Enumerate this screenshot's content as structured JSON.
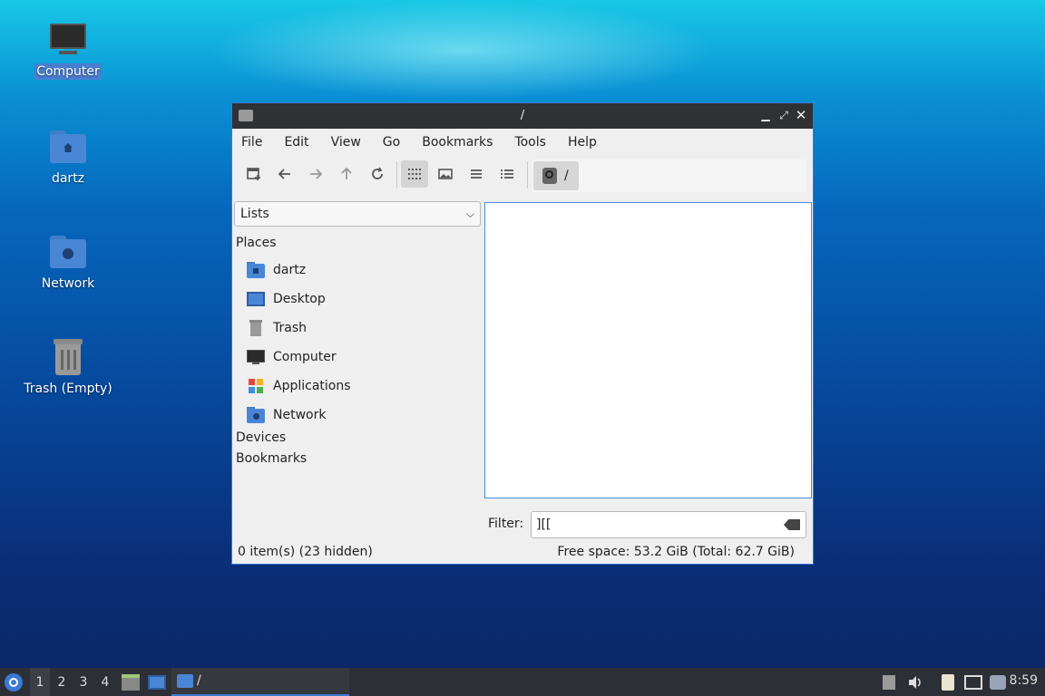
{
  "desktop": {
    "icons": [
      {
        "label": "Computer",
        "icon": "computer-icon"
      },
      {
        "label": "dartz",
        "icon": "home-folder-icon"
      },
      {
        "label": "Network",
        "icon": "network-folder-icon"
      },
      {
        "label": "Trash (Empty)",
        "icon": "trash-icon"
      }
    ]
  },
  "window": {
    "title": "/",
    "menu": [
      "File",
      "Edit",
      "View",
      "Go",
      "Bookmarks",
      "Tools",
      "Help"
    ],
    "path": "/",
    "side_combo": "Lists",
    "sections": {
      "places": "Places",
      "devices": "Devices",
      "bookmarks": "Bookmarks"
    },
    "places": [
      {
        "label": "dartz",
        "icon": "home-folder-icon"
      },
      {
        "label": "Desktop",
        "icon": "desktop-icon"
      },
      {
        "label": "Trash",
        "icon": "trash-icon"
      },
      {
        "label": "Computer",
        "icon": "computer-icon"
      },
      {
        "label": "Applications",
        "icon": "applications-icon"
      },
      {
        "label": "Network",
        "icon": "network-folder-icon"
      }
    ],
    "filter": {
      "label": "Filter:",
      "value": "][["
    },
    "status": {
      "items": "0 item(s) (23 hidden)",
      "space": "Free space: 53.2 GiB (Total: 62.7 GiB)"
    }
  },
  "taskbar": {
    "workspaces": [
      "1",
      "2",
      "3",
      "4"
    ],
    "task_title": "/",
    "clock": "8:59"
  },
  "colors": {
    "accent": "#3a7ad6",
    "folder": "#4a86d6",
    "titlebar": "#2f3134",
    "taskbar": "#2c2f35"
  }
}
